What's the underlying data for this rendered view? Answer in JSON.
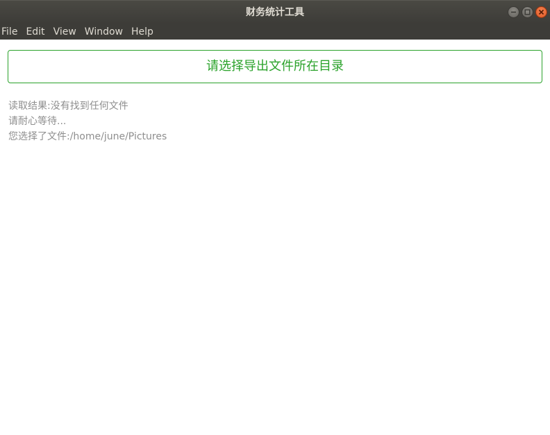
{
  "window": {
    "title": "财务统计工具"
  },
  "menubar": {
    "items": [
      "File",
      "Edit",
      "View",
      "Window",
      "Help"
    ]
  },
  "main": {
    "select_dir_button": "请选择导出文件所在目录",
    "log_lines": [
      "读取结果:没有找到任何文件",
      "请耐心等待...",
      "您选择了文件:/home/june/Pictures"
    ]
  },
  "colors": {
    "accent": "#2aa22a",
    "titlebar": "#3d3c38",
    "close_button": "#e9652e",
    "log_text": "#8e8e8e"
  },
  "icons": [
    "minimize-icon",
    "maximize-icon",
    "close-icon"
  ]
}
